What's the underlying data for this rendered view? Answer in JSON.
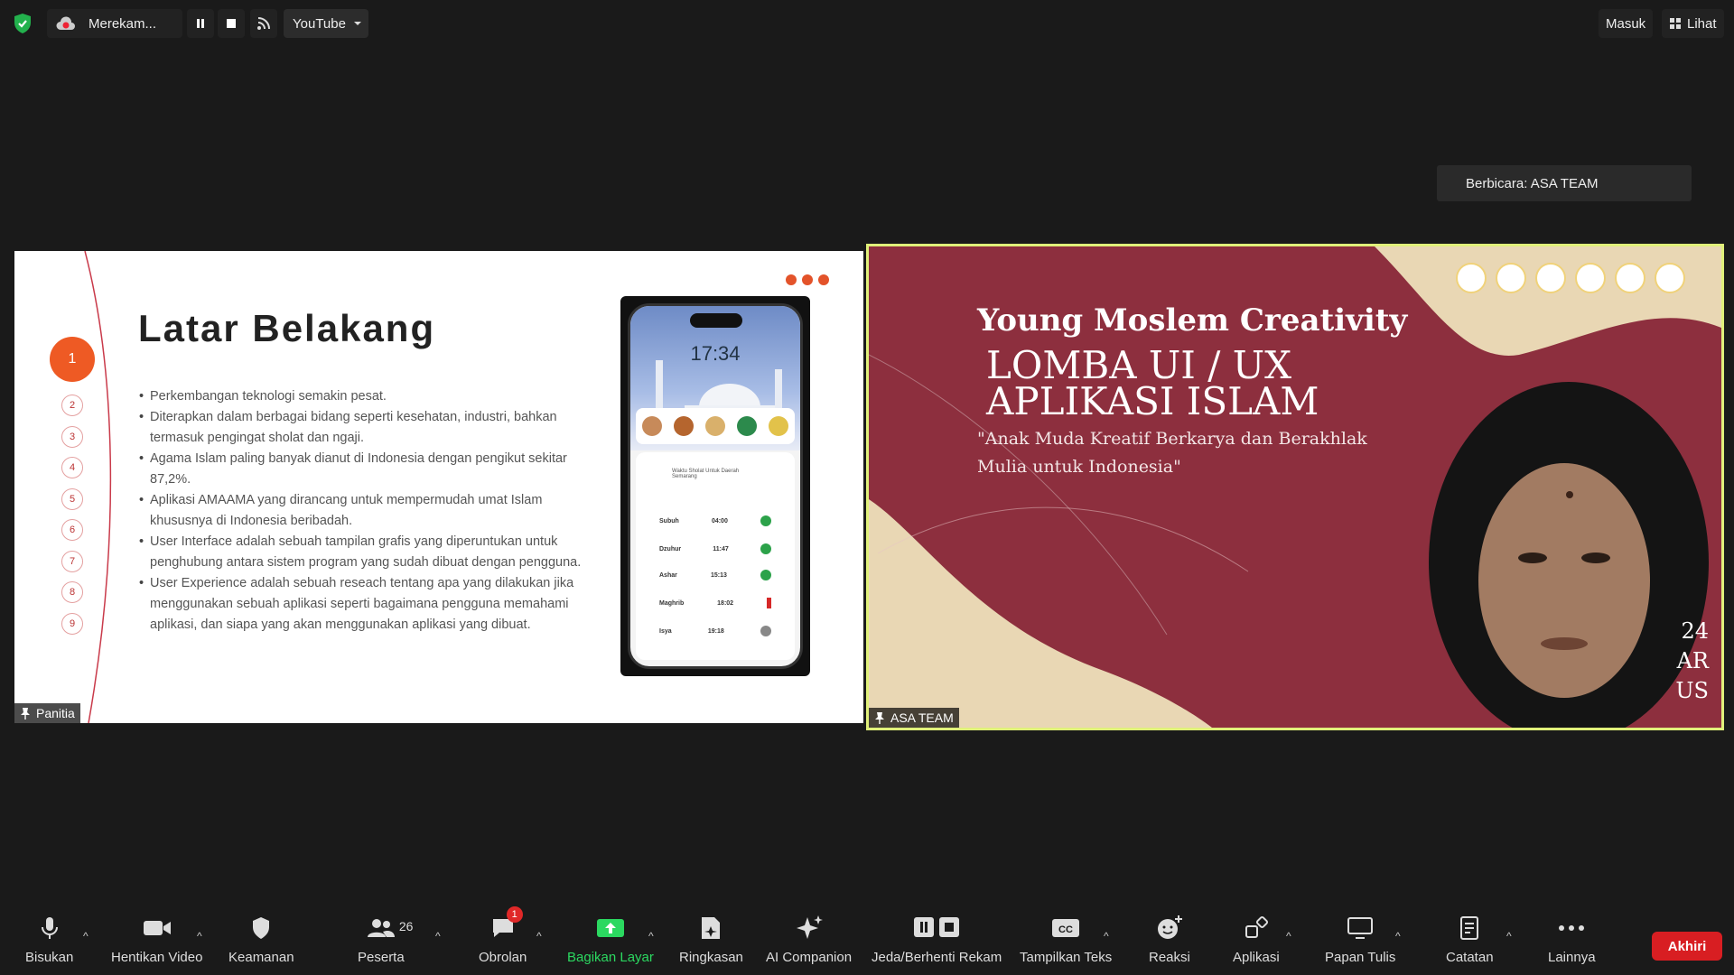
{
  "topbar": {
    "recording_label": "Merekam...",
    "stream_target": "YouTube",
    "sign_in_label": "Masuk",
    "view_label": "Lihat"
  },
  "speaking_indicator": "Berbicara: ASA TEAM",
  "slide": {
    "title": "Latar Belakang",
    "active_step": "1",
    "steps": [
      "2",
      "3",
      "4",
      "5",
      "6",
      "7",
      "8",
      "9"
    ],
    "bullets": [
      "Perkembangan teknologi semakin pesat.",
      "Diterapkan dalam berbagai bidang seperti kesehatan, industri, bahkan termasuk pengingat sholat dan ngaji.",
      "Agama Islam paling banyak dianut di Indonesia dengan pengikut sekitar 87,2%.",
      "Aplikasi AMAAMA yang dirancang untuk mempermudah umat Islam khususnya di Indonesia beribadah.",
      "User Interface adalah sebuah tampilan grafis yang diperuntukan untuk penghubung antara sistem program yang sudah dibuat dengan pengguna.",
      "User Experience adalah sebuah reseach tentang apa yang dilakukan jika menggunakan sebuah aplikasi seperti bagaimana pengguna memahami aplikasi, dan siapa yang akan menggunakan aplikasi yang dibuat."
    ],
    "phone": {
      "time": "17:34",
      "card_title": "Waktu Sholat Untuk Daerah Semarang",
      "prayers": [
        {
          "name": "Subuh",
          "time": "04:00",
          "status": "ok"
        },
        {
          "name": "Dzuhur",
          "time": "11:47",
          "status": "ok"
        },
        {
          "name": "Ashar",
          "time": "15:13",
          "status": "ok"
        },
        {
          "name": "Maghrib",
          "time": "18:02",
          "status": "missed"
        },
        {
          "name": "Isya",
          "time": "19:18",
          "status": "pending"
        }
      ]
    },
    "participant_label": "Panitia"
  },
  "video": {
    "title_line1": "Young Moslem Creativity",
    "title_line2": "LOMBA UI / UX",
    "title_line3": "APLIKASI ISLAM",
    "quote_line1": "\"Anak Muda Kreatif Berkarya dan Berakhlak",
    "quote_line2": "Mulia untuk Indonesia\"",
    "side_text": [
      "24",
      "AR",
      "US"
    ],
    "participant_label": "ASA TEAM"
  },
  "toolbar": {
    "mute": "Bisukan",
    "stop_video": "Hentikan Video",
    "security": "Keamanan",
    "participants": "Peserta",
    "participants_count": "26",
    "chat": "Obrolan",
    "chat_badge": "1",
    "share_screen": "Bagikan Layar",
    "summary": "Ringkasan",
    "ai_companion": "AI Companion",
    "pause_stop_record": "Jeda/Berhenti Rekam",
    "captions": "Tampilkan Teks",
    "reactions": "Reaksi",
    "apps": "Aplikasi",
    "whiteboard": "Papan Tulis",
    "notes": "Catatan",
    "more": "Lainnya",
    "end": "Akhiri"
  },
  "colors": {
    "accent_green": "#2bd860",
    "end_red": "#d81e22",
    "slide_orange": "#ee5a24",
    "speaker_border": "#e0f07a",
    "banner_maroon": "#8d2f3e"
  }
}
